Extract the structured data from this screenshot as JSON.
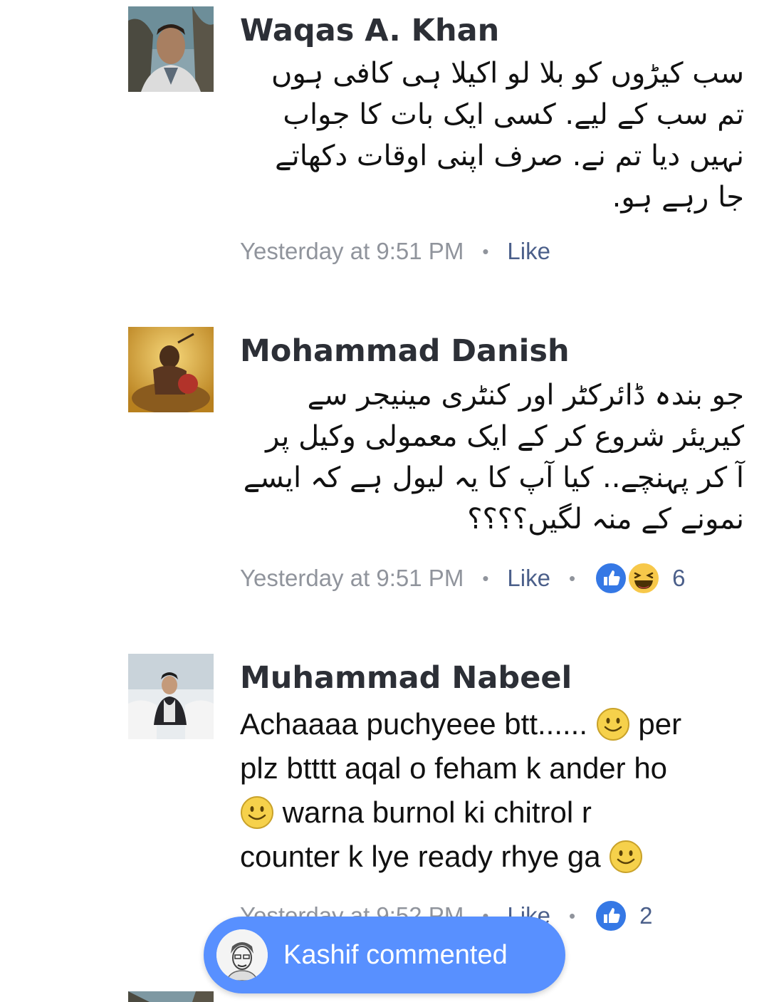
{
  "comments": [
    {
      "author": "Waqas A. Khan",
      "text_lines": [
        "سب کیڑوں کو بلا لو اکیلا ہی کافی ہوں",
        "تم سب کے لیے. کسی ایک بات کا جواب",
        "نہیں دیا تم نے. صرف اپنی اوقات دکھاتے",
        "جا رہے ہو."
      ],
      "time": "Yesterday at 9:51 PM",
      "like_label": "Like"
    },
    {
      "author": "Mohammad Danish",
      "text_lines": [
        "جو بندہ ڈائرکٹر اور کنٹری مینیجر سے",
        "کیریئر شروع کر  کے ایک معمولی وکیل پر",
        "آ کر پہنچے.. کیا آپ کا یہ لیول ہے کہ ایسے",
        "نمونے کے منہ لگیں؟؟؟؟"
      ],
      "time": "Yesterday at 9:51 PM",
      "like_label": "Like",
      "reaction_count": "6",
      "reactions": [
        "like-icon",
        "haha-icon"
      ]
    },
    {
      "author": "Muhammad Nabeel",
      "text_parts": {
        "p1": "Achaaaa puchyeee btt...... ",
        "p2": " per",
        "p3": "plz btttt aqal o feham k ander ho",
        "p4": " warna  burnol ki chitrol r",
        "p5": "counter k lye ready rhye ga "
      },
      "time": "Yesterday at 9:52 PM",
      "like_label": "Like",
      "reaction_count": "2",
      "reactions": [
        "like-icon"
      ]
    }
  ],
  "toast": {
    "text": "Kashif commented"
  },
  "colors": {
    "link": "#4b5f8a",
    "muted": "#90949c",
    "toast": "#5890ff",
    "like_blue": "#3578e5"
  }
}
